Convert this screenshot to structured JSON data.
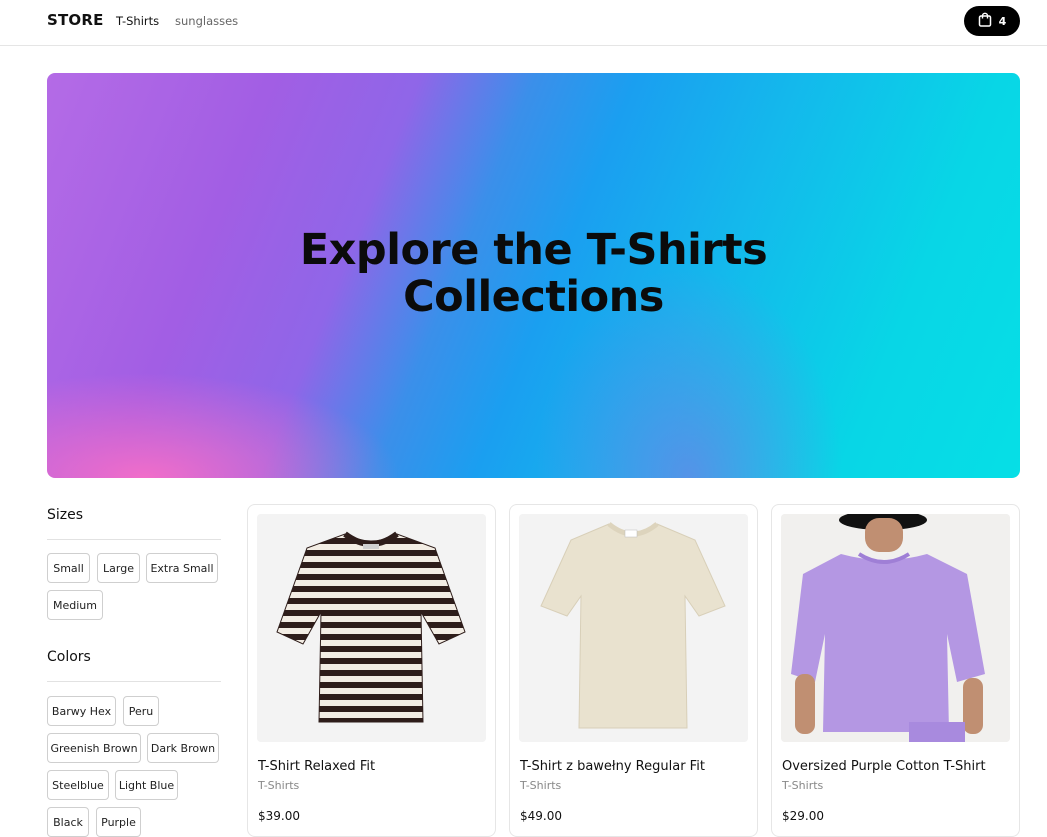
{
  "header": {
    "logo": "STORE",
    "nav": [
      "T-Shirts",
      "sunglasses"
    ],
    "cart_count": "4",
    "cart_icon": "shopping-bag-icon"
  },
  "hero": {
    "title_line1": "Explore the T-Shirts",
    "title_line2": "Collections"
  },
  "filters": {
    "sizes": {
      "heading": "Sizes",
      "options": [
        "Small",
        "Large",
        "Extra Small",
        "Medium"
      ]
    },
    "colors": {
      "heading": "Colors",
      "options": [
        "Barwy Hex",
        "Peru",
        "Greenish Brown",
        "Dark Brown",
        "Steelblue",
        "Light Blue",
        "Black",
        "Purple"
      ]
    }
  },
  "products": [
    {
      "name": "T-Shirt Relaxed Fit",
      "category": "T-Shirts",
      "price": "$39.00"
    },
    {
      "name": "T-Shirt z bawełny Regular Fit",
      "category": "T-Shirts",
      "price": "$49.00"
    },
    {
      "name": "Oversized Purple Cotton T-Shirt",
      "category": "T-Shirts",
      "price": "$29.00"
    }
  ],
  "colors": {
    "cart_bg": "#000000",
    "shirt_stripe_dark": "#2e1d1a",
    "shirt_beige": "#e9e2cf",
    "shirt_purple": "#b497e3"
  }
}
